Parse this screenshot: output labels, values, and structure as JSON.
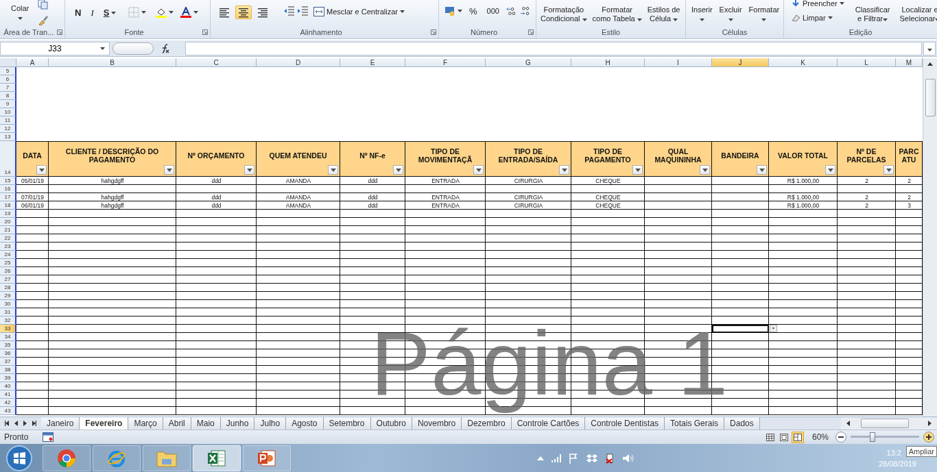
{
  "ribbon": {
    "groups": [
      {
        "kind": "clipboard",
        "label": "Área de Tran...",
        "launcher": true,
        "buttons": [
          "Colar"
        ]
      },
      {
        "kind": "font",
        "label": "Fonte",
        "launcher": true,
        "buttons": [
          "N",
          "I",
          "S"
        ]
      },
      {
        "kind": "alignment",
        "label": "Alinhamento",
        "launcher": true,
        "align": [
          {
            "selected": false
          },
          {
            "selected": true
          },
          {
            "selected": false
          }
        ],
        "buttons": [
          "Mesclar e Centralizar"
        ]
      },
      {
        "kind": "number",
        "label": "Número",
        "launcher": true,
        "buttons": [
          "%",
          "000"
        ]
      },
      {
        "kind": "styles",
        "label": "Estilo",
        "launcher": false,
        "large": [
          [
            "Formatação",
            "Condicional"
          ],
          [
            "Formatar",
            "como Tabela"
          ],
          [
            "Estilos de",
            "Célula"
          ]
        ]
      },
      {
        "kind": "cells",
        "label": "Células",
        "launcher": false,
        "large": [
          [
            "Inserir"
          ],
          [
            "Excluir"
          ],
          [
            "Formatar"
          ]
        ]
      },
      {
        "kind": "editing",
        "label": "Edição",
        "launcher": false,
        "buttons": [
          "Preencher",
          "Limpar"
        ],
        "large": [
          [
            "Classificar",
            "e Filtrar"
          ],
          [
            "Localizar e",
            "Selecionar"
          ]
        ]
      }
    ]
  },
  "formula_bar": {
    "name_box": "J33"
  },
  "columns": [
    {
      "letter": "A",
      "selected": false
    },
    {
      "letter": "B",
      "selected": false
    },
    {
      "letter": "C",
      "selected": false
    },
    {
      "letter": "D",
      "selected": false
    },
    {
      "letter": "E",
      "selected": false
    },
    {
      "letter": "F",
      "selected": false
    },
    {
      "letter": "G",
      "selected": false
    },
    {
      "letter": "H",
      "selected": false
    },
    {
      "letter": "I",
      "selected": false
    },
    {
      "letter": "J",
      "selected": true
    },
    {
      "letter": "K",
      "selected": false
    },
    {
      "letter": "L",
      "selected": false
    },
    {
      "letter": "M",
      "selected": false
    }
  ],
  "rows": [
    {
      "number": "5",
      "kind": "blank",
      "selected": false
    },
    {
      "number": "6",
      "kind": "blank",
      "selected": false
    },
    {
      "number": "7",
      "kind": "blank",
      "selected": false
    },
    {
      "number": "8",
      "kind": "blank",
      "selected": false
    },
    {
      "number": "9",
      "kind": "blank",
      "selected": false
    },
    {
      "number": "10",
      "kind": "blank",
      "selected": false
    },
    {
      "number": "11",
      "kind": "blank",
      "selected": false
    },
    {
      "number": "12",
      "kind": "blank",
      "selected": false
    },
    {
      "number": "13",
      "kind": "blank",
      "selected": false
    },
    {
      "number": "14",
      "kind": "header",
      "selected": false,
      "cells": [
        {
          "text": "DATA",
          "filter": true
        },
        {
          "text": "CLIENTE / DESCRIÇÃO DO PAGAMENTO",
          "filter": true
        },
        {
          "text": "Nº ORÇAMENTO",
          "filter": true
        },
        {
          "text": "QUEM ATENDEU",
          "filter": true
        },
        {
          "text": "Nº NF-e",
          "filter": true
        },
        {
          "text": "TIPO DE MOVIMENTAÇÃ",
          "filter": true
        },
        {
          "text": "TIPO DE ENTRADA/SAÍDA",
          "filter": true
        },
        {
          "text": "TIPO DE PAGAMENTO",
          "filter": true
        },
        {
          "text": "QUAL MAQUININHA",
          "filter": true
        },
        {
          "text": "BANDEIRA",
          "filter": true
        },
        {
          "text": "VALOR TOTAL",
          "filter": true
        },
        {
          "text": "Nº DE PARCELAS",
          "filter": true
        },
        {
          "text": "PARC ATU",
          "filter": false
        }
      ]
    },
    {
      "number": "15",
      "kind": "data",
      "selected": false,
      "cells": [
        "05/01/19",
        "hahgdgff",
        "ddd",
        "AMANDA",
        "ddd",
        "ENTRADA",
        "CIRURGIA",
        "CHEQUE",
        "",
        "",
        "R$ 1.000,00",
        "2",
        "2"
      ]
    },
    {
      "number": "16",
      "kind": "data",
      "selected": false
    },
    {
      "number": "17",
      "kind": "data",
      "selected": false,
      "cells": [
        "07/01/19",
        "hahgdgff",
        "ddd",
        "AMANDA",
        "ddd",
        "ENTRADA",
        "CIRURGIA",
        "CHEQUE",
        "",
        "",
        "R$ 1.000,00",
        "2",
        "2"
      ]
    },
    {
      "number": "18",
      "kind": "data",
      "selected": false,
      "cells": [
        "06/01/19",
        "hahgdgff",
        "ddd",
        "AMANDA",
        "ddd",
        "ENTRADA",
        "CIRURGIA",
        "CHEQUE",
        "",
        "",
        "R$ 1.000,00",
        "2",
        "3"
      ]
    },
    {
      "number": "19",
      "kind": "data",
      "selected": false
    },
    {
      "number": "20",
      "kind": "data",
      "selected": false
    },
    {
      "number": "21",
      "kind": "data",
      "selected": false
    },
    {
      "number": "22",
      "kind": "data",
      "selected": false
    },
    {
      "number": "23",
      "kind": "data",
      "selected": false
    },
    {
      "number": "24",
      "kind": "data",
      "selected": false
    },
    {
      "number": "25",
      "kind": "data",
      "selected": false
    },
    {
      "number": "26",
      "kind": "data",
      "selected": false
    },
    {
      "number": "27",
      "kind": "data",
      "selected": false
    },
    {
      "number": "28",
      "kind": "data",
      "selected": false
    },
    {
      "number": "29",
      "kind": "data",
      "selected": false
    },
    {
      "number": "30",
      "kind": "data",
      "selected": false
    },
    {
      "number": "31",
      "kind": "data",
      "selected": false
    },
    {
      "number": "32",
      "kind": "data",
      "selected": false
    },
    {
      "number": "33",
      "kind": "data",
      "selected": true
    },
    {
      "number": "34",
      "kind": "data",
      "selected": false
    },
    {
      "number": "35",
      "kind": "data",
      "selected": false
    },
    {
      "number": "36",
      "kind": "data",
      "selected": false
    },
    {
      "number": "37",
      "kind": "data",
      "selected": false
    },
    {
      "number": "38",
      "kind": "data",
      "selected": false
    },
    {
      "number": "39",
      "kind": "data",
      "selected": false
    },
    {
      "number": "40",
      "kind": "data",
      "selected": false
    },
    {
      "number": "41",
      "kind": "data",
      "selected": false
    },
    {
      "number": "42",
      "kind": "data",
      "selected": false
    },
    {
      "number": "43",
      "kind": "data",
      "selected": false
    }
  ],
  "page_label": "Página 1",
  "sheet_tabs": [
    {
      "label": "Janeiro",
      "selected": false
    },
    {
      "label": "Fevereiro",
      "selected": true
    },
    {
      "label": "Março",
      "selected": false
    },
    {
      "label": "Abril",
      "selected": false
    },
    {
      "label": "Maio",
      "selected": false
    },
    {
      "label": "Junho",
      "selected": false
    },
    {
      "label": "Julho",
      "selected": false
    },
    {
      "label": "Agosto",
      "selected": false
    },
    {
      "label": "Setembro",
      "selected": false
    },
    {
      "label": "Outubro",
      "selected": false
    },
    {
      "label": "Novembro",
      "selected": false
    },
    {
      "label": "Dezembro",
      "selected": false
    },
    {
      "label": "Controle Cartões",
      "selected": false
    },
    {
      "label": "Controle Dentistas",
      "selected": false
    },
    {
      "label": "Totais Gerais",
      "selected": false
    },
    {
      "label": "Dados",
      "selected": false
    }
  ],
  "status_bar": {
    "status": "Pronto",
    "views": [
      {
        "selected": false
      },
      {
        "selected": false
      },
      {
        "selected": true
      }
    ],
    "zoom": "60%",
    "zoom_level": {
      "level": 0.32
    },
    "tooltip": "Ampliar"
  },
  "taskbar": {
    "apps": [
      {
        "kind": "chrome",
        "selected": false
      },
      {
        "kind": "ie",
        "selected": false
      },
      {
        "kind": "folder",
        "selected": false
      },
      {
        "kind": "excel",
        "selected": true
      },
      {
        "kind": "powerpoint",
        "selected": false
      }
    ],
    "time": "13:2",
    "date": "28/08/2019"
  }
}
